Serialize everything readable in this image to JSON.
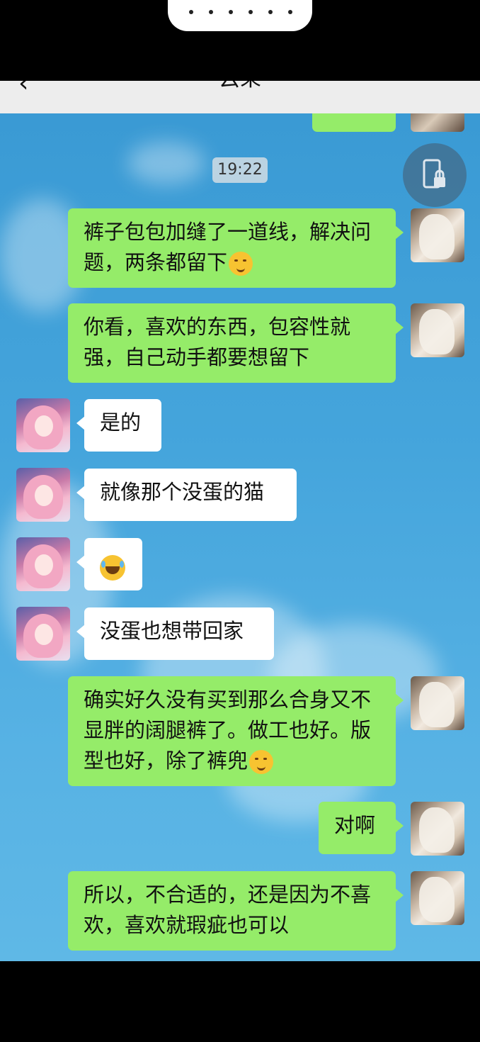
{
  "header": {
    "title": "云朵",
    "back_icon": "chevron-left-icon",
    "more_icon": "more-dots-icon"
  },
  "timestamp": "19:22",
  "messages": [
    {
      "side": "me",
      "text": "裤子包包加缝了一道线，解决问题，两条都留下",
      "emoji": "thinking-face-emoji"
    },
    {
      "side": "me",
      "text": "你看，喜欢的东西，包容性就强，自己动手都要想留下"
    },
    {
      "side": "them",
      "text": "是的"
    },
    {
      "side": "them",
      "text": "就像那个没蛋的猫"
    },
    {
      "side": "them",
      "text": "",
      "emoji": "laughing-tears-emoji"
    },
    {
      "side": "them",
      "text": "没蛋也想带回家"
    },
    {
      "side": "me",
      "text": "确实好久没有买到那么合身又不显胖的阔腿裤了。做工也好。版型也好，除了裤兜",
      "emoji": "thinking-face-emoji"
    },
    {
      "side": "me",
      "text": "对啊"
    },
    {
      "side": "me",
      "text": "所以，不合适的，还是因为不喜欢，喜欢就瑕疵也可以"
    }
  ],
  "colors": {
    "my_bubble": "#95ec69",
    "their_bubble": "#ffffff",
    "background": "#45a5dc"
  },
  "icons": {
    "lock": "phone-lock-icon"
  }
}
